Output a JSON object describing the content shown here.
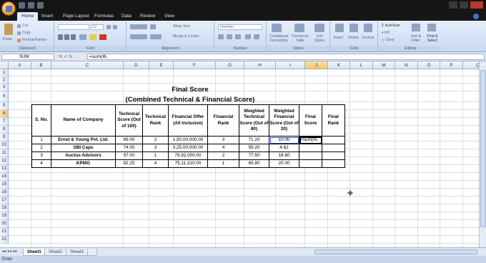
{
  "ribbon": {
    "tabs": [
      "Home",
      "Insert",
      "Page Layout",
      "Formulas",
      "Data",
      "Review",
      "View"
    ],
    "clipboard": {
      "paste": "Paste",
      "cut": "Cut",
      "copy": "Copy",
      "format_painter": "Format Painter",
      "label": "Clipboard"
    },
    "font": {
      "size": "12",
      "label": "Font"
    },
    "alignment": {
      "wrap": "Wrap Text",
      "merge": "Merge & Center",
      "label": "Alignment"
    },
    "number": {
      "format": "Number",
      "label": "Number"
    },
    "styles": {
      "conditional": "Conditional Formatting",
      "format_table": "Format as Table",
      "cell_styles": "Cell Styles",
      "label": "Styles"
    },
    "cells": {
      "insert": "Insert",
      "delete": "Delete",
      "format": "Format",
      "label": "Cells"
    },
    "editing": {
      "autosum": "AutoSum",
      "fill": "Fill",
      "clear": "Clear",
      "sort": "Sort & Filter",
      "find": "Find & Select",
      "label": "Editing"
    }
  },
  "formula_bar": {
    "name_box": "SUM",
    "formula": "=sum(I6,"
  },
  "columns": [
    "A",
    "B",
    "C",
    "D",
    "E",
    "F",
    "G",
    "H",
    "I",
    "J",
    "K",
    "L",
    "M",
    "N",
    "O",
    "P",
    "Q"
  ],
  "rows": [
    "1",
    "2",
    "3",
    "4",
    "5",
    "6",
    "7",
    "8",
    "9",
    "10",
    "11",
    "12",
    "13",
    "14",
    "15",
    "16",
    "17",
    "18",
    "19",
    "20",
    "21",
    "22"
  ],
  "sheet": {
    "title_line1": "Final Score",
    "title_line2": "(Combined Technical & Financial Score)",
    "headers": [
      "S. No.",
      "Name of Company",
      "Technical Score (Out of 100)",
      "Technical Rank",
      "Financial Offer (All Inclusive)",
      "Financial Rank",
      "Weighted Technical Score (Out of 80)",
      "Weighted Financial Score (Out of 20)",
      "Final Score",
      "Final Rank"
    ],
    "rows": [
      [
        "1",
        "Ernst & Young Pvt. Ltd.",
        "89.00",
        "2",
        "1,50,00,000.00",
        "3",
        "71.20",
        "10.00",
        "=sum(I6,",
        ""
      ],
      [
        "2",
        "SBI Caps",
        "74.00",
        "3",
        "3,25,00,000.00",
        "4",
        "59.20",
        "4.62",
        "",
        ""
      ],
      [
        "3",
        "Auctus Advisors",
        "97.00",
        "1",
        "79,92,000.00",
        "2",
        "77.60",
        "18.80",
        "",
        ""
      ],
      [
        "4",
        "KPMG",
        "82.25",
        "4",
        "75,11,310.00",
        "1",
        "65.80",
        "20.00",
        "",
        ""
      ]
    ]
  },
  "sheet_tabs": [
    "Sheet1",
    "Sheet2",
    "Sheet3"
  ],
  "status": {
    "mode": "Enter"
  }
}
